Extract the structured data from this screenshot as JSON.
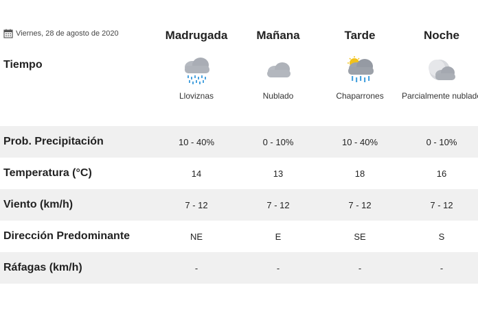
{
  "date": "Viernes, 28 de agosto de 2020",
  "section_title": "Tiempo",
  "periods": [
    {
      "name": "Madrugada",
      "condition": "Lloviznas",
      "icon": "drizzle-icon"
    },
    {
      "name": "Mañana",
      "condition": "Nublado",
      "icon": "cloudy-icon"
    },
    {
      "name": "Tarde",
      "condition": "Chaparrones",
      "icon": "sun-showers-icon"
    },
    {
      "name": "Noche",
      "condition": "Parcialmente nublado",
      "icon": "partly-cloudy-night-icon"
    }
  ],
  "rows": [
    {
      "label": "Prob. Precipitación",
      "values": [
        "10 - 40%",
        "0 - 10%",
        "10 - 40%",
        "0 - 10%"
      ]
    },
    {
      "label": "Temperatura (°C)",
      "values": [
        "14",
        "13",
        "18",
        "16"
      ]
    },
    {
      "label": "Viento (km/h)",
      "values": [
        "7 - 12",
        "7 - 12",
        "7 - 12",
        "7 - 12"
      ]
    },
    {
      "label": "Dirección Predominante",
      "values": [
        "NE",
        "E",
        "SE",
        "S"
      ]
    },
    {
      "label": "Ráfagas (km/h)",
      "values": [
        "-",
        "-",
        "-",
        "-"
      ]
    }
  ]
}
